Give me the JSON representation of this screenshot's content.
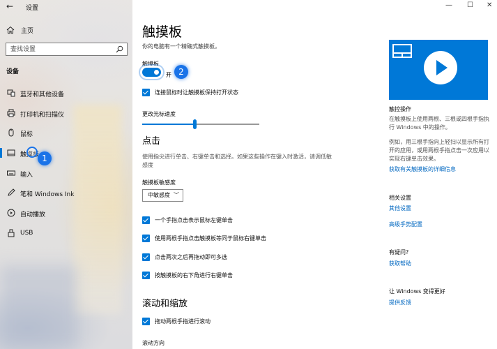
{
  "window": {
    "back": "←",
    "title": "设置",
    "minimize": "—",
    "maximize": "☐",
    "close": "✕"
  },
  "sidebar": {
    "home": "主页",
    "search_placeholder": "查找设置",
    "section": "设备",
    "items": [
      {
        "label": "蓝牙和其他设备",
        "icon": "bluetooth-icon"
      },
      {
        "label": "打印机和扫描仪",
        "icon": "printer-icon"
      },
      {
        "label": "鼠标",
        "icon": "mouse-icon"
      },
      {
        "label": "触摸板",
        "icon": "touchpad-icon",
        "active": true
      },
      {
        "label": "输入",
        "icon": "keyboard-icon"
      },
      {
        "label": "笔和 Windows Ink",
        "icon": "pen-icon"
      },
      {
        "label": "自动播放",
        "icon": "autoplay-icon"
      },
      {
        "label": "USB",
        "icon": "usb-icon"
      }
    ],
    "badge": "1"
  },
  "main": {
    "title": "触摸板",
    "subtitle": "你的电脑有一个精确式触摸板。",
    "toggle_label": "触摸板",
    "toggle_state": "开",
    "toggle_on": true,
    "badge": "2",
    "keep_on_label": "连接鼠标时让触摸板保持打开状态",
    "cursor_speed_label": "更改光标速度",
    "cursor_speed_fraction": 0.45,
    "tap_heading": "点击",
    "tap_desc": "使用指尖进行单击、右键单击和选择。如果这些操作在键入时激活，请调低敏感度",
    "sensitivity_label": "触摸板敏感度",
    "sensitivity_value": "中敏感度",
    "tap_options": [
      "一个手指点击表示鼠标左键单击",
      "使用两根手指点击触摸板等同于鼠标右键单击",
      "点击两次之后再拖动即可多选",
      "按触摸板的右下角进行右键单击"
    ],
    "scroll_heading": "滚动和缩放",
    "scroll_option": "拖动两根手指进行滚动",
    "scroll_direction_label": "滚动方向"
  },
  "right": {
    "gestures_title": "触控操作",
    "gestures_text1": "在触摸板上使用两根、三根或四根手指执行 Windows 中的操作。",
    "gestures_text2": "例如，用三根手指向上轻扫以显示所有打开的应用，或用两根手指点击一次应用以实现右键单击效果。",
    "gestures_link": "获取有关触摸板的详细信息",
    "related_title": "相关设置",
    "related_links": [
      "其他设置",
      "高级手势配置"
    ],
    "question_title": "有疑问?",
    "help_link": "获取帮助",
    "improve_title": "让 Windows 变得更好",
    "feedback_link": "提供反馈"
  },
  "colors": {
    "accent": "#0078d7",
    "link": "#0067c0",
    "badge": "#1a73e8"
  }
}
